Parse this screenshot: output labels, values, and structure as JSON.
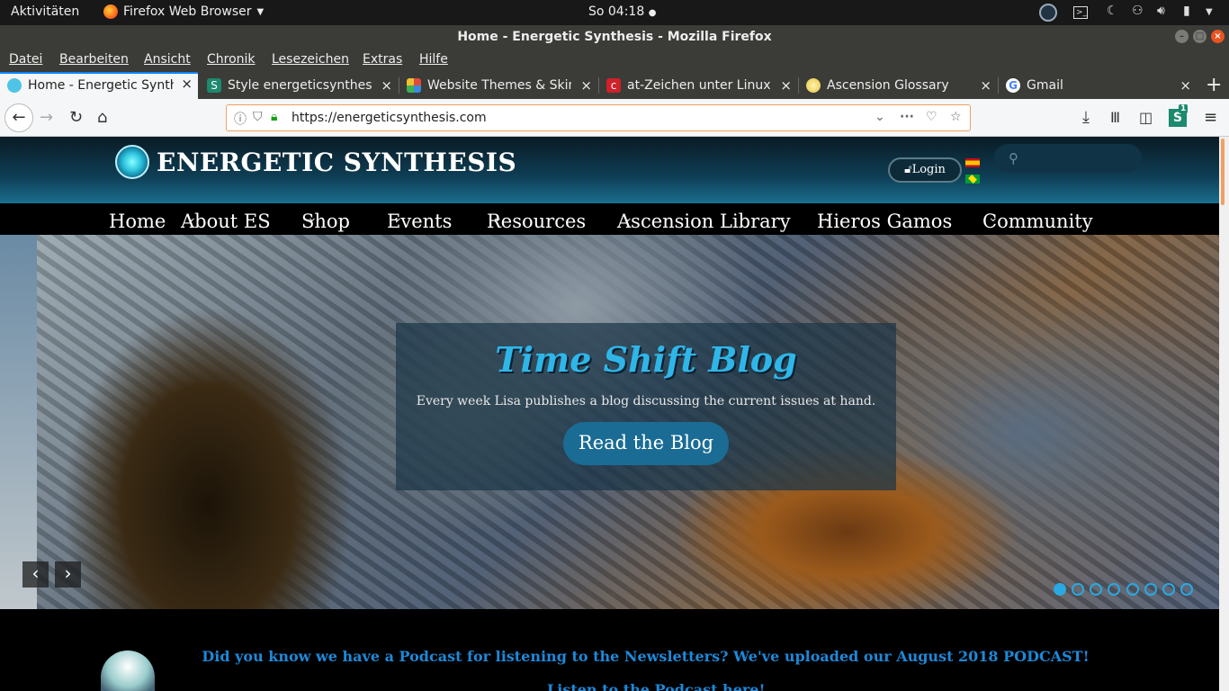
{
  "gnome": {
    "activities": "Aktivitäten",
    "app_name": "Firefox Web Browser",
    "clock": "So 04:18"
  },
  "window": {
    "title": "Home - Energetic Synthesis - Mozilla Firefox"
  },
  "menu": [
    "Datei",
    "Bearbeiten",
    "Ansicht",
    "Chronik",
    "Lesezeichen",
    "Extras",
    "Hilfe"
  ],
  "tabs": [
    {
      "label": "Home - Energetic Synthe",
      "active": true,
      "favicon": "energetic-synthesis-favicon",
      "color": "#4ec4e6"
    },
    {
      "label": "Style energeticsynthesis",
      "active": false,
      "favicon": "stylish-favicon",
      "color": "#1b8a6e"
    },
    {
      "label": "Website Themes & Skins",
      "active": false,
      "favicon": "themes-favicon",
      "color": "#e04a3a"
    },
    {
      "label": "at-Zeichen unter Linux ei",
      "active": false,
      "favicon": "linux-site-favicon",
      "color": "#d0202a"
    },
    {
      "label": "Ascension Glossary",
      "active": false,
      "favicon": "glossary-favicon",
      "color": "#e8c040"
    },
    {
      "label": "Gmail",
      "active": false,
      "favicon": "google-favicon",
      "color": "#ffffff"
    }
  ],
  "urlbar": {
    "url": "https://energeticsynthesis.com"
  },
  "toolbar": {
    "ext_badge": "1"
  },
  "site": {
    "logo_text": "ENERGETIC SYNTHESIS",
    "login_label": "Login",
    "nav": [
      "Home",
      "About ES",
      "Shop",
      "Events",
      "Resources",
      "Ascension Library",
      "Hieros Gamos",
      "Community"
    ],
    "nav_has_dropdown": [
      false,
      true,
      true,
      true,
      true,
      true,
      true,
      true
    ],
    "hero_title": "Time Shift Blog",
    "hero_subtitle": "Every week Lisa publishes a blog discussing the current issues at hand.",
    "hero_button": "Read the Blog",
    "slide_count": 8,
    "podcast_text": "Did you know we have a Podcast for listening to the Newsletters? We've uploaded our August 2018 PODCAST!",
    "podcast_link": "Listen to the Podcast here!"
  }
}
